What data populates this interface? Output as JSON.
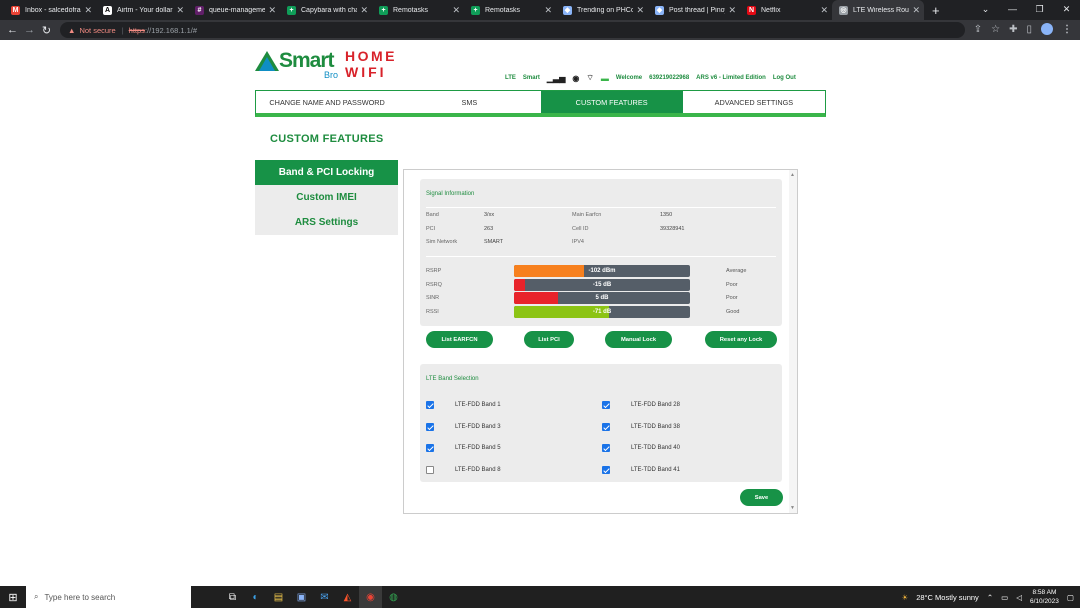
{
  "browser": {
    "tabs": [
      {
        "title": "Inbox - salcedofra",
        "icon": "gmail-icon",
        "color": "#ea4335",
        "glyph": "M"
      },
      {
        "title": "Airtm - Your dollar",
        "icon": "airtm-icon",
        "color": "#ffffff",
        "glyph": "A"
      },
      {
        "title": "queue-management",
        "icon": "slack-icon",
        "color": "#611f69",
        "glyph": "#"
      },
      {
        "title": "Capybara with cha",
        "icon": "sheets-icon",
        "color": "#0f9d58",
        "glyph": "+"
      },
      {
        "title": "Remotasks",
        "icon": "sheets-icon",
        "color": "#0f9d58",
        "glyph": "+"
      },
      {
        "title": "Remotasks",
        "icon": "sheets-icon",
        "color": "#0f9d58",
        "glyph": "+"
      },
      {
        "title": "Trending on PHCor",
        "icon": "shield-icon",
        "color": "#8ab4f8",
        "glyph": "◆"
      },
      {
        "title": "Post thread | Pinoy",
        "icon": "shield-icon",
        "color": "#8ab4f8",
        "glyph": "◆"
      },
      {
        "title": "Netflix",
        "icon": "netflix-icon",
        "color": "#e50914",
        "glyph": "N"
      },
      {
        "title": "LTE Wireless Route",
        "icon": "globe-icon",
        "color": "#9aa0a6",
        "glyph": "◎"
      }
    ],
    "not_secure": "Not secure",
    "url_proto": "https",
    "url_rest": "://192.168.1.1/#"
  },
  "logo": {
    "smart": "Smart",
    "bro": "Bro",
    "home": "HOME",
    "wifi": "WIFI"
  },
  "status": {
    "network": "LTE",
    "carrier": "Smart",
    "welcome": "Welcome",
    "number": "639219022968",
    "version": "ARS v6 - Limited Edition",
    "logout": "Log Out"
  },
  "nav": {
    "tabs": [
      "CHANGE NAME AND PASSWORD",
      "SMS",
      "CUSTOM FEATURES",
      "ADVANCED SETTINGS"
    ],
    "active": 2
  },
  "page_title": "CUSTOM FEATURES",
  "side_menu": [
    "Band & PCI Locking",
    "Custom IMEI",
    "ARS Settings"
  ],
  "signal": {
    "title": "Signal Information",
    "info": [
      {
        "label": "Band",
        "value": "3/xx",
        "label2": "Main Earfcn",
        "value2": "1350"
      },
      {
        "label": "PCI",
        "value": "263",
        "label2": "Cell ID",
        "value2": "39328941"
      },
      {
        "label": "Sim Network",
        "value": "SMART",
        "label2": "IPV4",
        "value2": ""
      }
    ],
    "bars": [
      {
        "label": "RSRP",
        "value": "-102 dBm",
        "level": 0.4,
        "color": "#f7801e",
        "quality": "Average"
      },
      {
        "label": "RSRQ",
        "value": "-15 dB",
        "level": 0.06,
        "color": "#e8232a",
        "quality": "Poor"
      },
      {
        "label": "SINR",
        "value": "5 dB",
        "level": 0.25,
        "color": "#e8232a",
        "quality": "Poor"
      },
      {
        "label": "RSSI",
        "value": "-71 dB",
        "level": 0.54,
        "color": "#8cc414",
        "quality": "Good"
      }
    ]
  },
  "buttons": {
    "list_earfcn": "List EARFCN",
    "list_pci": "List PCI",
    "manual_lock": "Manual Lock",
    "reset_lock": "Reset any Lock",
    "save": "Save"
  },
  "band_selection": {
    "title": "LTE Band Selection",
    "left": [
      {
        "label": "LTE-FDD Band 1",
        "checked": true
      },
      {
        "label": "LTE-FDD Band 3",
        "checked": true
      },
      {
        "label": "LTE-FDD Band 5",
        "checked": true
      },
      {
        "label": "LTE-FDD Band 8",
        "checked": false
      }
    ],
    "right": [
      {
        "label": "LTE-FDD Band 28",
        "checked": true
      },
      {
        "label": "LTE-TDD Band 38",
        "checked": true
      },
      {
        "label": "LTE-TDD Band 40",
        "checked": true
      },
      {
        "label": "LTE-TDD Band 41",
        "checked": true
      }
    ]
  },
  "taskbar": {
    "search_placeholder": "Type here to search",
    "weather": "28°C  Mostly sunny",
    "time": "8:58 AM",
    "date": "6/10/2023"
  },
  "colors": {
    "brand_green": "#179247",
    "brand_red": "#d8222a"
  }
}
